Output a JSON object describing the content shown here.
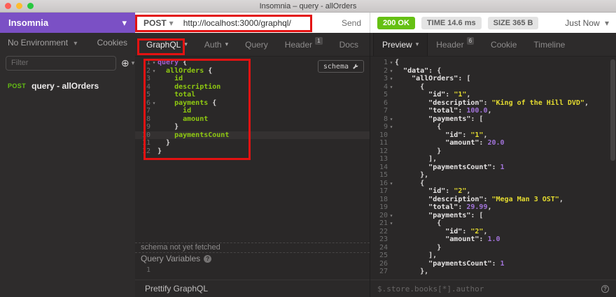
{
  "window": {
    "title": "Insomnia – query - allOrders"
  },
  "icons": {
    "caret_down": "▾",
    "plus": "⊕",
    "help": "?",
    "fold": "▾"
  },
  "colors": {
    "purple": "#7b50c5",
    "green": "#65c013",
    "red": "#e31212",
    "kw": "#a35fd1",
    "fld": "#8fc911",
    "str": "#e5dc30",
    "num": "#a173d9",
    "light_red": "#ff5f57",
    "light_yellow": "#febc2e",
    "light_green": "#28c840"
  },
  "sidebar": {
    "app_title": "Insomnia",
    "environment_label": "No Environment",
    "cookies_label": "Cookies",
    "filter_placeholder": "Filter",
    "request_item": {
      "method": "POST",
      "name": "query - allOrders"
    }
  },
  "request_bar": {
    "method": "POST",
    "url": "http://localhost:3000/graphql/",
    "send_label": "Send"
  },
  "response_bar": {
    "status": "200 OK",
    "time_label": "TIME 14.6 ms",
    "size_label": "SIZE 365 B",
    "timestamp": "Just Now"
  },
  "request_tabs": {
    "graphql": "GraphQL",
    "auth": "Auth",
    "query": "Query",
    "header": "Header",
    "header_badge": "1",
    "docs": "Docs"
  },
  "response_tabs": {
    "preview": "Preview",
    "header": "Header",
    "header_badge": "6",
    "cookie": "Cookie",
    "timeline": "Timeline"
  },
  "graphql_editor": {
    "schema_button_label": "schema",
    "schema_status": "schema not yet fetched",
    "variables_label": "Query Variables",
    "variables_line_number": "1",
    "prettify_button_label": "Prettify GraphQL",
    "lines": [
      {
        "n": 1,
        "fold": true,
        "tokens": [
          {
            "c": "kw",
            "t": "query"
          },
          {
            "c": "pun",
            "t": " {"
          }
        ]
      },
      {
        "n": 2,
        "fold": true,
        "tokens": [
          {
            "c": "fld",
            "t": "  allOrders"
          },
          {
            "c": "pun",
            "t": " {"
          }
        ]
      },
      {
        "n": 3,
        "tokens": [
          {
            "c": "fld",
            "t": "    id"
          }
        ]
      },
      {
        "n": 4,
        "tokens": [
          {
            "c": "fld",
            "t": "    description"
          }
        ]
      },
      {
        "n": 5,
        "tokens": [
          {
            "c": "fld",
            "t": "    total"
          }
        ]
      },
      {
        "n": 6,
        "fold": true,
        "tokens": [
          {
            "c": "fld",
            "t": "    payments"
          },
          {
            "c": "pun",
            "t": " {"
          }
        ]
      },
      {
        "n": 7,
        "tokens": [
          {
            "c": "fld",
            "t": "      id"
          }
        ]
      },
      {
        "n": 8,
        "tokens": [
          {
            "c": "fld",
            "t": "      amount"
          }
        ]
      },
      {
        "n": 9,
        "tokens": [
          {
            "c": "pun",
            "t": "    }"
          }
        ]
      },
      {
        "n": 10,
        "active": true,
        "tokens": [
          {
            "c": "fld",
            "t": "    paymentsCount"
          }
        ]
      },
      {
        "n": 11,
        "tokens": [
          {
            "c": "pun",
            "t": "  }"
          }
        ]
      },
      {
        "n": 12,
        "tokens": [
          {
            "c": "pun",
            "t": "}"
          }
        ]
      }
    ]
  },
  "response_pane": {
    "filter_placeholder": "$.store.books[*].author",
    "lines": [
      {
        "n": 1,
        "fold": true,
        "tokens": [
          {
            "c": "pun",
            "t": "{"
          }
        ]
      },
      {
        "n": 2,
        "fold": true,
        "tokens": [
          {
            "c": "pun",
            "t": "  "
          },
          {
            "c": "key",
            "t": "\"data\""
          },
          {
            "c": "pun",
            "t": ": {"
          }
        ]
      },
      {
        "n": 3,
        "fold": true,
        "tokens": [
          {
            "c": "pun",
            "t": "    "
          },
          {
            "c": "key",
            "t": "\"allOrders\""
          },
          {
            "c": "pun",
            "t": ": ["
          }
        ]
      },
      {
        "n": 4,
        "fold": true,
        "tokens": [
          {
            "c": "pun",
            "t": "      {"
          }
        ]
      },
      {
        "n": 5,
        "tokens": [
          {
            "c": "pun",
            "t": "        "
          },
          {
            "c": "key",
            "t": "\"id\""
          },
          {
            "c": "pun",
            "t": ": "
          },
          {
            "c": "str",
            "t": "\"1\""
          },
          {
            "c": "pun",
            "t": ","
          }
        ]
      },
      {
        "n": 6,
        "tokens": [
          {
            "c": "pun",
            "t": "        "
          },
          {
            "c": "key",
            "t": "\"description\""
          },
          {
            "c": "pun",
            "t": ": "
          },
          {
            "c": "str",
            "t": "\"King of the Hill DVD\""
          },
          {
            "c": "pun",
            "t": ","
          }
        ]
      },
      {
        "n": 7,
        "tokens": [
          {
            "c": "pun",
            "t": "        "
          },
          {
            "c": "key",
            "t": "\"total\""
          },
          {
            "c": "pun",
            "t": ": "
          },
          {
            "c": "num",
            "t": "100.0"
          },
          {
            "c": "pun",
            "t": ","
          }
        ]
      },
      {
        "n": 8,
        "fold": true,
        "tokens": [
          {
            "c": "pun",
            "t": "        "
          },
          {
            "c": "key",
            "t": "\"payments\""
          },
          {
            "c": "pun",
            "t": ": ["
          }
        ]
      },
      {
        "n": 9,
        "fold": true,
        "tokens": [
          {
            "c": "pun",
            "t": "          {"
          }
        ]
      },
      {
        "n": 10,
        "tokens": [
          {
            "c": "pun",
            "t": "            "
          },
          {
            "c": "key",
            "t": "\"id\""
          },
          {
            "c": "pun",
            "t": ": "
          },
          {
            "c": "str",
            "t": "\"1\""
          },
          {
            "c": "pun",
            "t": ","
          }
        ]
      },
      {
        "n": 11,
        "tokens": [
          {
            "c": "pun",
            "t": "            "
          },
          {
            "c": "key",
            "t": "\"amount\""
          },
          {
            "c": "pun",
            "t": ": "
          },
          {
            "c": "num",
            "t": "20.0"
          }
        ]
      },
      {
        "n": 12,
        "tokens": [
          {
            "c": "pun",
            "t": "          }"
          }
        ]
      },
      {
        "n": 13,
        "tokens": [
          {
            "c": "pun",
            "t": "        ],"
          }
        ]
      },
      {
        "n": 14,
        "tokens": [
          {
            "c": "pun",
            "t": "        "
          },
          {
            "c": "key",
            "t": "\"paymentsCount\""
          },
          {
            "c": "pun",
            "t": ": "
          },
          {
            "c": "num",
            "t": "1"
          }
        ]
      },
      {
        "n": 15,
        "tokens": [
          {
            "c": "pun",
            "t": "      },"
          }
        ]
      },
      {
        "n": 16,
        "fold": true,
        "tokens": [
          {
            "c": "pun",
            "t": "      {"
          }
        ]
      },
      {
        "n": 17,
        "tokens": [
          {
            "c": "pun",
            "t": "        "
          },
          {
            "c": "key",
            "t": "\"id\""
          },
          {
            "c": "pun",
            "t": ": "
          },
          {
            "c": "str",
            "t": "\"2\""
          },
          {
            "c": "pun",
            "t": ","
          }
        ]
      },
      {
        "n": 18,
        "tokens": [
          {
            "c": "pun",
            "t": "        "
          },
          {
            "c": "key",
            "t": "\"description\""
          },
          {
            "c": "pun",
            "t": ": "
          },
          {
            "c": "str",
            "t": "\"Mega Man 3 OST\""
          },
          {
            "c": "pun",
            "t": ","
          }
        ]
      },
      {
        "n": 19,
        "tokens": [
          {
            "c": "pun",
            "t": "        "
          },
          {
            "c": "key",
            "t": "\"total\""
          },
          {
            "c": "pun",
            "t": ": "
          },
          {
            "c": "num",
            "t": "29.99"
          },
          {
            "c": "pun",
            "t": ","
          }
        ]
      },
      {
        "n": 20,
        "fold": true,
        "tokens": [
          {
            "c": "pun",
            "t": "        "
          },
          {
            "c": "key",
            "t": "\"payments\""
          },
          {
            "c": "pun",
            "t": ": ["
          }
        ]
      },
      {
        "n": 21,
        "fold": true,
        "tokens": [
          {
            "c": "pun",
            "t": "          {"
          }
        ]
      },
      {
        "n": 22,
        "tokens": [
          {
            "c": "pun",
            "t": "            "
          },
          {
            "c": "key",
            "t": "\"id\""
          },
          {
            "c": "pun",
            "t": ": "
          },
          {
            "c": "str",
            "t": "\"2\""
          },
          {
            "c": "pun",
            "t": ","
          }
        ]
      },
      {
        "n": 23,
        "tokens": [
          {
            "c": "pun",
            "t": "            "
          },
          {
            "c": "key",
            "t": "\"amount\""
          },
          {
            "c": "pun",
            "t": ": "
          },
          {
            "c": "num",
            "t": "1.0"
          }
        ]
      },
      {
        "n": 24,
        "tokens": [
          {
            "c": "pun",
            "t": "          }"
          }
        ]
      },
      {
        "n": 25,
        "tokens": [
          {
            "c": "pun",
            "t": "        ],"
          }
        ]
      },
      {
        "n": 26,
        "tokens": [
          {
            "c": "pun",
            "t": "        "
          },
          {
            "c": "key",
            "t": "\"paymentsCount\""
          },
          {
            "c": "pun",
            "t": ": "
          },
          {
            "c": "num",
            "t": "1"
          }
        ]
      },
      {
        "n": 27,
        "tokens": [
          {
            "c": "pun",
            "t": "      },"
          }
        ]
      }
    ]
  }
}
